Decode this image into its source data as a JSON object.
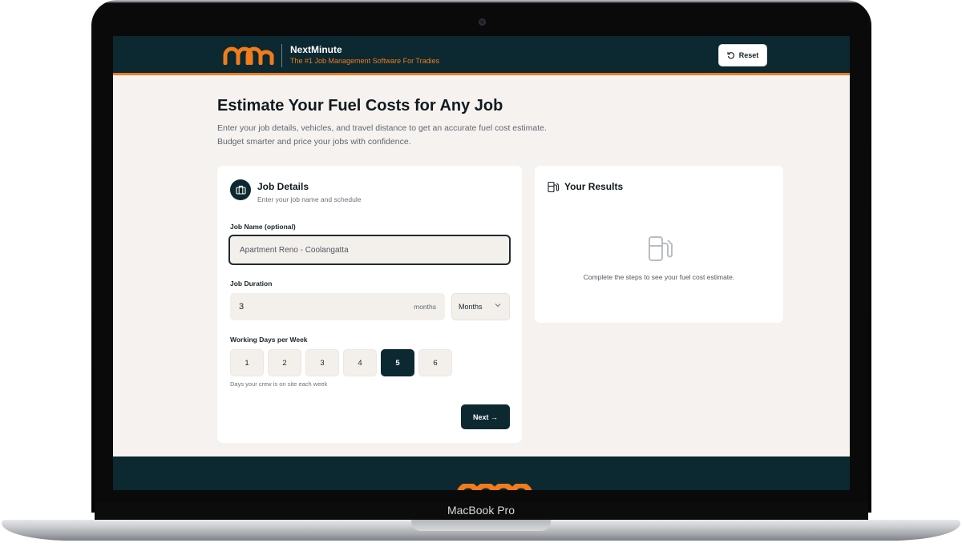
{
  "device": {
    "label": "MacBook Pro"
  },
  "header": {
    "app_name": "NextMinute",
    "tagline": "The #1 Job Management Software For Tradies",
    "reset_label": "Reset"
  },
  "page": {
    "title": "Estimate Your Fuel Costs for Any Job",
    "subtitle_line1": "Enter your job details, vehicles, and travel distance to get an accurate fuel cost estimate.",
    "subtitle_line2": "Budget smarter and price your jobs with confidence."
  },
  "job_details": {
    "title": "Job Details",
    "subtitle": "Enter your job name and schedule",
    "job_name_label": "Job Name (optional)",
    "job_name_value": "Apartment Reno - Coolangatta",
    "duration_label": "Job Duration",
    "duration_value": "3",
    "duration_unit_suffix": "months",
    "duration_unit_selected": "Months",
    "days_label": "Working Days per Week",
    "days": [
      "1",
      "2",
      "3",
      "4",
      "5",
      "6"
    ],
    "days_selected": "5",
    "days_help": "Days your crew is on site each week",
    "next_label": "Next →"
  },
  "results": {
    "title": "Your Results",
    "empty_message": "Complete the steps to see your fuel cost estimate."
  },
  "colors": {
    "brand_dark": "#0c2830",
    "brand_orange": "#f07c1d",
    "page_bg": "#f5f2ef"
  },
  "icons": {
    "reset": "reset-icon",
    "job_details": "briefcase-icon",
    "results": "fuel-pump-icon",
    "empty_state": "fuel-pump-icon",
    "select": "chevron-down-icon"
  }
}
